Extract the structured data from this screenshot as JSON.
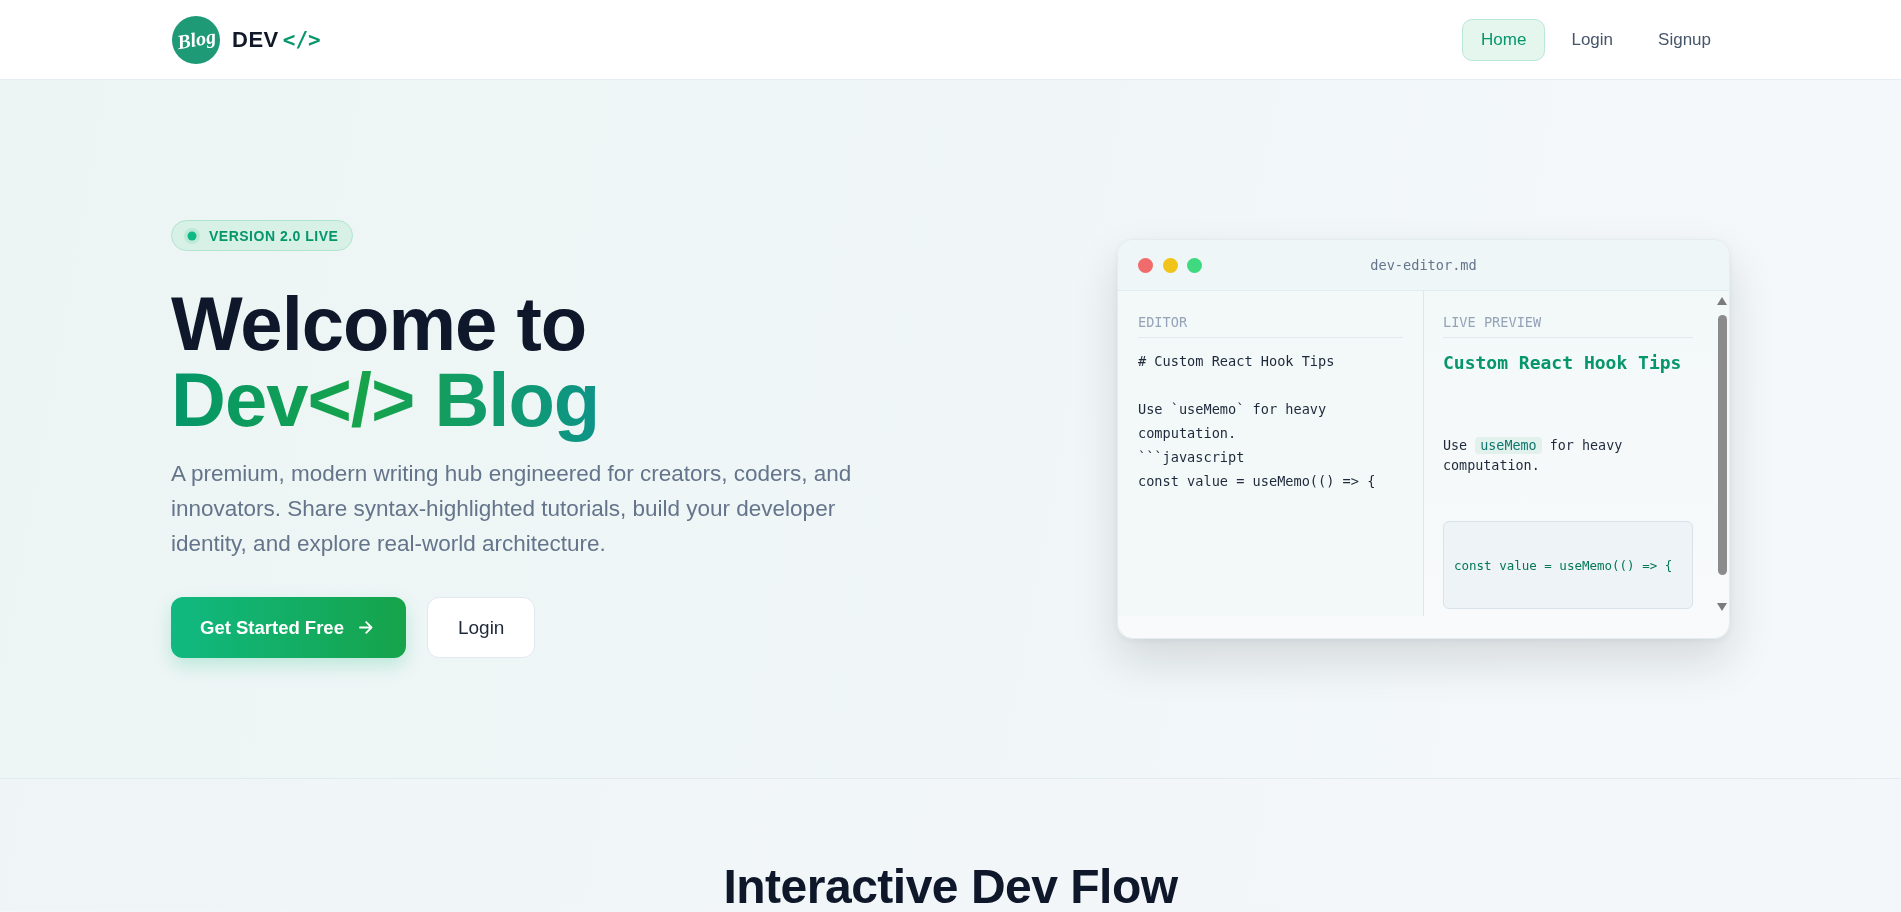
{
  "header": {
    "logo": {
      "mark": "Blog",
      "wordmark": "DEV",
      "wordmark_accent": "</>"
    },
    "nav": [
      {
        "label": "Home",
        "selected": true
      },
      {
        "label": "Login",
        "selected": false
      },
      {
        "label": "Signup",
        "selected": false
      }
    ]
  },
  "hero": {
    "badge": "VERSION 2.0 LIVE",
    "title": "Welcome to",
    "title_highlight": "Dev</> Blog",
    "description": "A premium, modern writing hub engineered for creators, coders, and innovators. Share syntax-highlighted tutorials, build your developer identity, and explore real-world architecture.",
    "buttons": [
      {
        "label": "Get Started Free",
        "kind": "primary"
      },
      {
        "label": "Login",
        "kind": "secondary"
      }
    ]
  },
  "editor_window": {
    "title": "dev-editor.md",
    "window_controls": [
      {
        "color": "#f06b6b"
      },
      {
        "color": "#f1c419"
      },
      {
        "color": "#3fd97f"
      }
    ],
    "editor": {
      "label": "EDITOR",
      "content": "# Custom React Hook Tips\n\nUse `useMemo` for heavy computation.\n```javascript\nconst value = useMemo(() => {"
    },
    "preview": {
      "label": "LIVE PREVIEW",
      "heading": "Custom React Hook Tips",
      "paragraph": [
        {
          "kind": "text",
          "text": "Use"
        },
        {
          "kind": "code",
          "text": "useMemo"
        },
        {
          "kind": "text",
          "text": "for heavy computation."
        }
      ],
      "code_block": "const value = useMemo(() => {"
    }
  },
  "next_section": {
    "title": "Interactive Dev Flow"
  }
}
